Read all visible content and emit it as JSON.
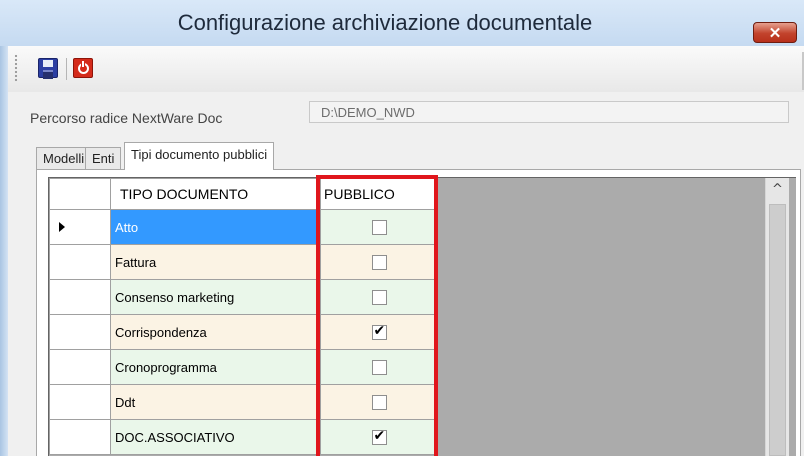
{
  "window": {
    "title": "Configurazione archiviazione documentale",
    "close_glyph": "✕"
  },
  "toolbar": {
    "save_icon": "save-icon",
    "exit_icon": "power-icon"
  },
  "path": {
    "label": "Percorso radice NextWare Doc",
    "value": "D:\\DEMO_NWD"
  },
  "tabs": [
    {
      "label": "Modelli",
      "active": false
    },
    {
      "label": "Enti",
      "active": false
    },
    {
      "label": "Tipi documento pubblici",
      "active": true
    }
  ],
  "grid": {
    "columns": [
      "TIPO DOCUMENTO",
      "PUBBLICO"
    ],
    "rows": [
      {
        "tipo": "Atto",
        "pubblico": false,
        "selected": true
      },
      {
        "tipo": "Fattura",
        "pubblico": false,
        "selected": false
      },
      {
        "tipo": "Consenso marketing",
        "pubblico": false,
        "selected": false
      },
      {
        "tipo": "Corrispondenza",
        "pubblico": true,
        "selected": false
      },
      {
        "tipo": "Cronoprogramma",
        "pubblico": false,
        "selected": false
      },
      {
        "tipo": "Ddt",
        "pubblico": false,
        "selected": false
      },
      {
        "tipo": "DOC.ASSOCIATIVO",
        "pubblico": true,
        "selected": false
      }
    ],
    "scroll_up_glyph": "^"
  },
  "colors": {
    "highlight": "#e0161c",
    "selection": "#3399ff",
    "row_green": "#eaf7ea",
    "row_beige": "#fbf3e4"
  }
}
